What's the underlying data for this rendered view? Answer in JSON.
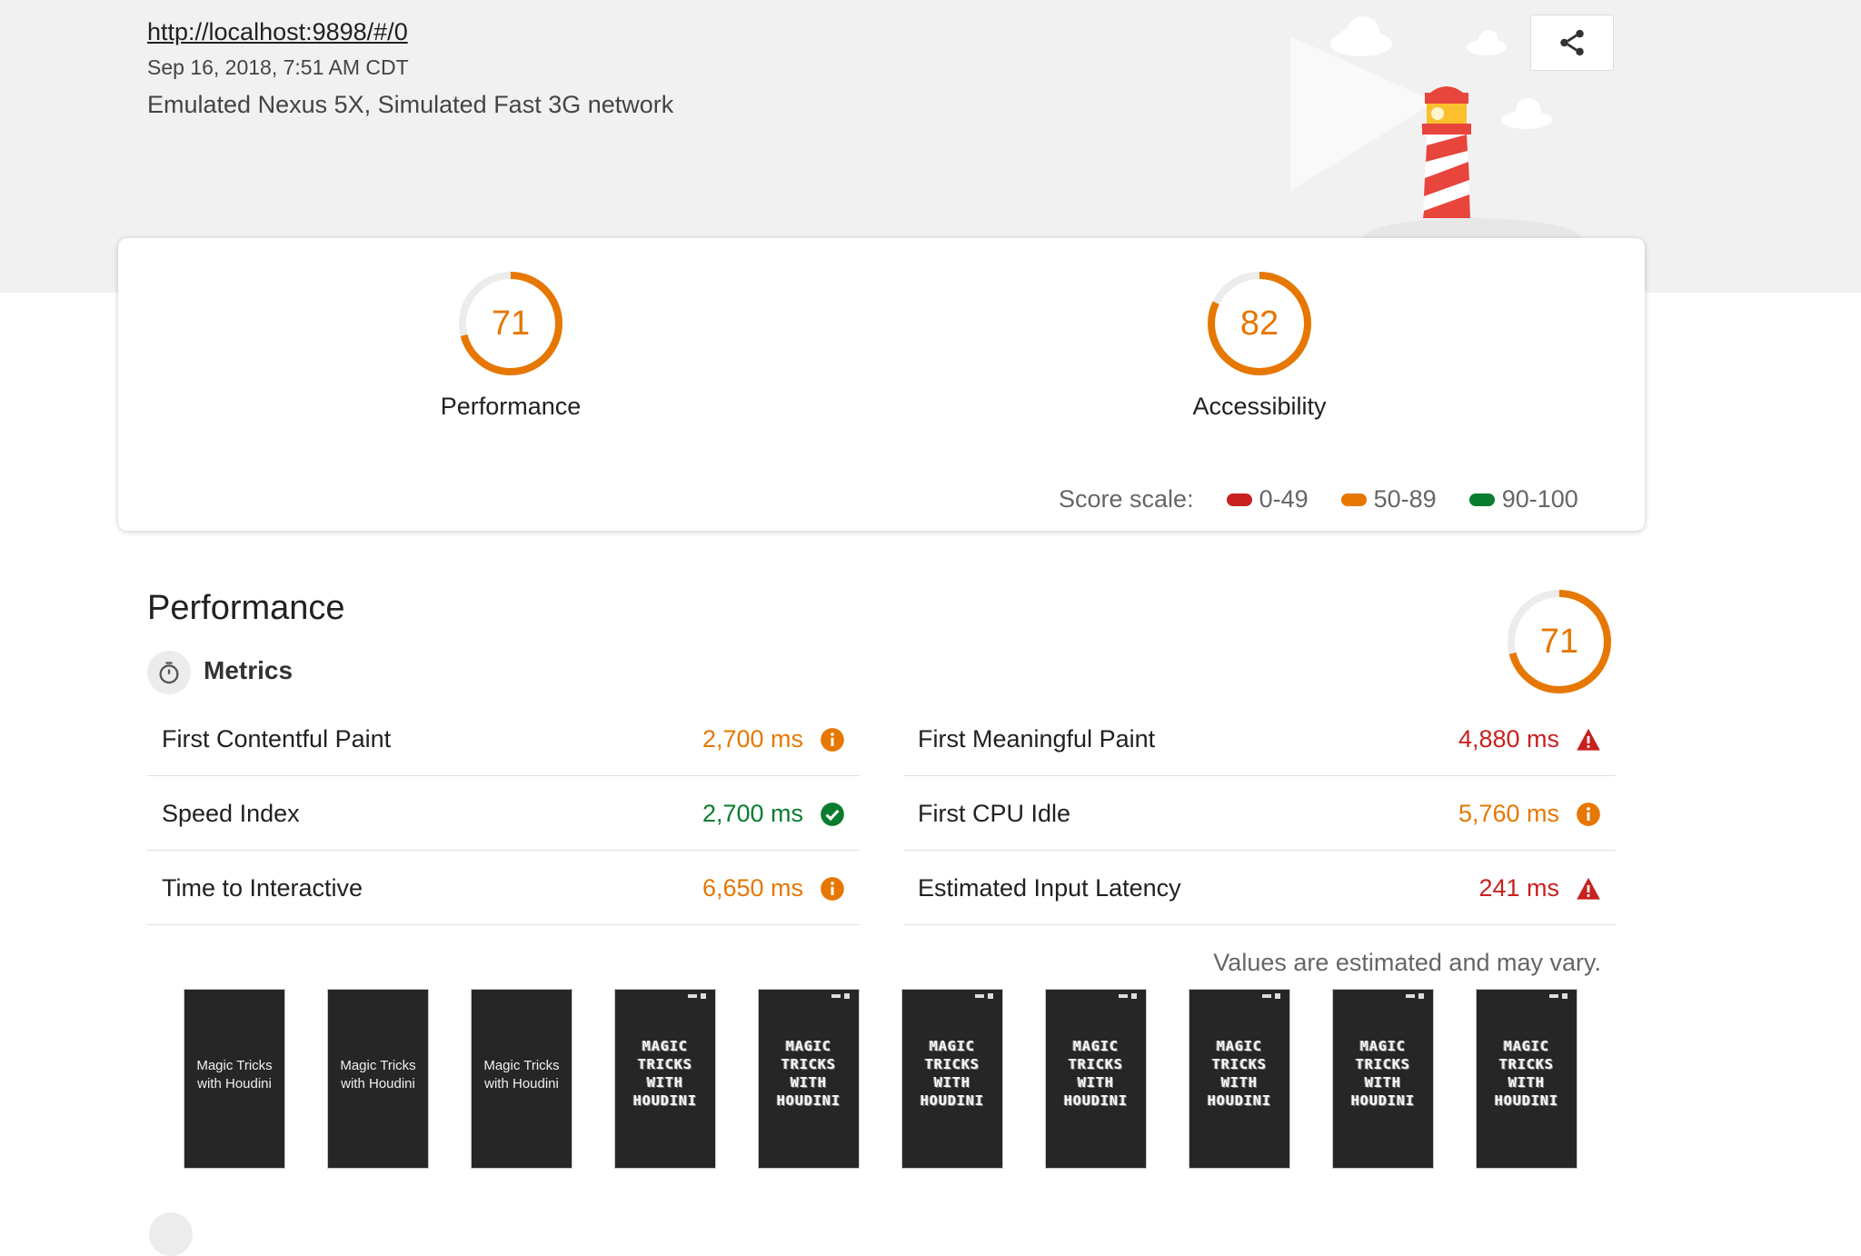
{
  "header": {
    "url": "http://localhost:9898/#/0",
    "datetime": "Sep 16, 2018, 7:51 AM CDT",
    "environment": "Emulated Nexus 5X, Simulated Fast 3G network",
    "share_icon": "share-icon"
  },
  "summary": {
    "categories": [
      {
        "label": "Performance",
        "score": "71",
        "score_value": 71,
        "color": "#e67700"
      },
      {
        "label": "Accessibility",
        "score": "82",
        "score_value": 82,
        "color": "#e67700"
      }
    ],
    "scale": {
      "label": "Score scale:",
      "ranges": [
        {
          "label": "0-49",
          "color": "#c7221f"
        },
        {
          "label": "50-89",
          "color": "#e67700"
        },
        {
          "label": "90-100",
          "color": "#0a7c2e"
        }
      ]
    }
  },
  "performance": {
    "title": "Performance",
    "score": "71",
    "score_value": 71,
    "metrics_label": "Metrics",
    "metrics_icon": "stopwatch-icon",
    "metrics": [
      {
        "name": "First Contentful Paint",
        "value": "2,700 ms",
        "status": "average",
        "icon": "info-icon"
      },
      {
        "name": "First Meaningful Paint",
        "value": "4,880 ms",
        "status": "fail",
        "icon": "warning-icon"
      },
      {
        "name": "Speed Index",
        "value": "2,700 ms",
        "status": "pass",
        "icon": "check-icon"
      },
      {
        "name": "First CPU Idle",
        "value": "5,760 ms",
        "status": "average",
        "icon": "info-icon"
      },
      {
        "name": "Time to Interactive",
        "value": "6,650 ms",
        "status": "average",
        "icon": "info-icon"
      },
      {
        "name": "Estimated Input Latency",
        "value": "241 ms",
        "status": "fail",
        "icon": "warning-icon"
      }
    ],
    "note": "Values are estimated and may vary.",
    "filmstrip": [
      {
        "text": "Magic Tricks with Houdini",
        "style": "plain"
      },
      {
        "text": "Magic Tricks with Houdini",
        "style": "plain"
      },
      {
        "text": "Magic Tricks with Houdini",
        "style": "plain"
      },
      {
        "text": "MAGIC TRICKS WITH HOUDINI",
        "style": "pixel"
      },
      {
        "text": "MAGIC TRICKS WITH HOUDINI",
        "style": "pixel"
      },
      {
        "text": "MAGIC TRICKS WITH HOUDINI",
        "style": "pixel"
      },
      {
        "text": "MAGIC TRICKS WITH HOUDINI",
        "style": "pixel"
      },
      {
        "text": "MAGIC TRICKS WITH HOUDINI",
        "style": "pixel"
      },
      {
        "text": "MAGIC TRICKS WITH HOUDINI",
        "style": "pixel"
      },
      {
        "text": "MAGIC TRICKS WITH HOUDINI",
        "style": "pixel"
      }
    ]
  }
}
